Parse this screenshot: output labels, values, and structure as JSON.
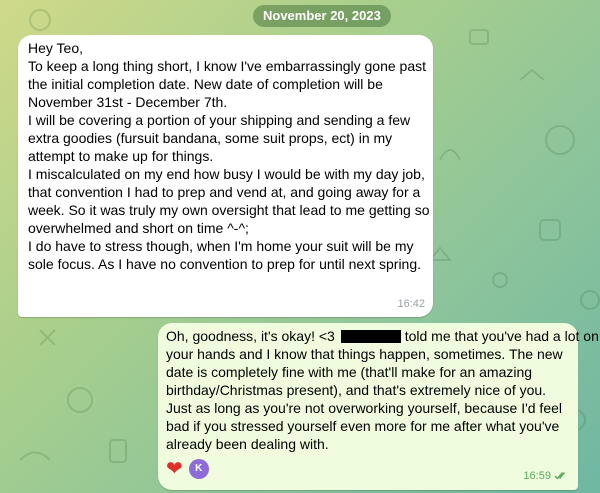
{
  "chat": {
    "date_label": "November 20, 2023",
    "messages": [
      {
        "direction": "incoming",
        "lines": [
          "Hey Teo,",
          "To keep a long thing short, I know I've embarrassingly gone past",
          "the initial completion date. New date of completion will be",
          "November 31st - December 7th.",
          "I will be covering a portion of your shipping and sending a few",
          "extra goodies (fursuit bandana, some suit props, ect) in my",
          "attempt to make up for things.",
          "",
          "I miscalculated on my end how busy I would be with my day job,",
          "that convention I had to prep and vend at, and going away for a",
          "week. So it was truly my own oversight that lead to me getting so",
          "overwhelmed and short on time ^-^;",
          "",
          "I do have to stress though, when I'm home your suit will be my",
          "sole focus. As I have no convention to prep for until next spring."
        ],
        "time": "16:42"
      },
      {
        "direction": "outgoing",
        "line1_before_redaction": "Oh, goodness, it's okay! <3",
        "line1_after_redaction": "told me that you've had a lot on",
        "lines": [
          "your hands and I know that things happen, sometimes. The new",
          "date is completely fine with me (that'll make for an amazing",
          "birthday/Christmas present), and that's extremely nice of you.",
          "Just as long as you're not overworking yourself, because I'd feel",
          "bad if you stressed yourself even more for me after what you've",
          "already been dealing with."
        ],
        "time": "16:59",
        "read_status_icon": "double-check-icon",
        "reactions": {
          "emoji": "❤",
          "reactor_initial": "K"
        }
      }
    ]
  },
  "colors": {
    "incoming_bubble": "#ffffff",
    "outgoing_bubble": "#effdde",
    "time_outgoing": "#5ba85a",
    "date_pill": "#4c7940"
  }
}
